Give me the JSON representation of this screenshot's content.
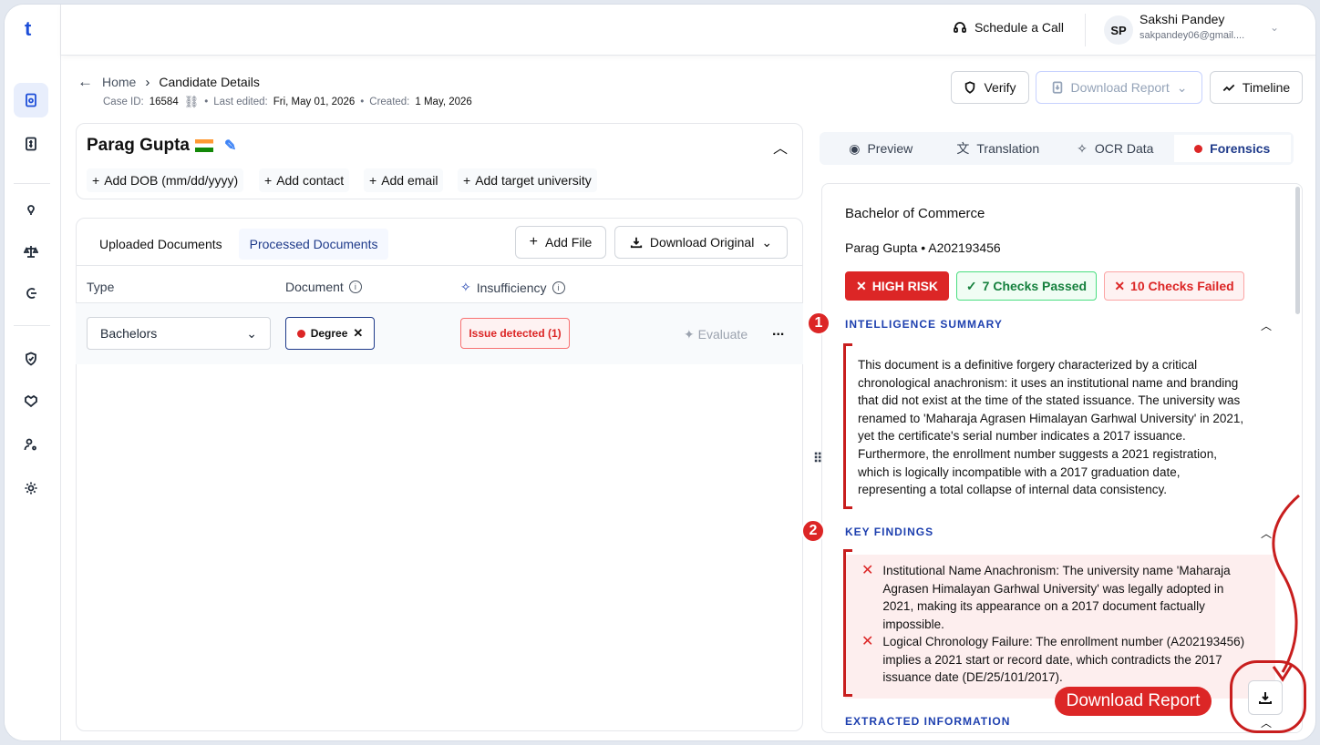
{
  "topbar": {
    "schedule_label": "Schedule a Call",
    "user_initials": "SP",
    "user_name": "Sakshi Pandey",
    "user_email": "sakpandey06@gmail...."
  },
  "breadcrumb": {
    "home": "Home",
    "current": "Candidate Details"
  },
  "meta": {
    "case_label": "Case ID:",
    "case_id": "16584",
    "edited_label": "Last edited:",
    "edited": "Fri, May 01, 2026",
    "created_label": "Created:",
    "created": "1 May, 2026"
  },
  "actions": {
    "verify": "Verify",
    "download_report": "Download Report",
    "timeline": "Timeline"
  },
  "candidate": {
    "name": "Parag Gupta",
    "add_links": [
      "Add DOB (mm/dd/yyyy)",
      "Add contact",
      "Add email",
      "Add target university"
    ]
  },
  "documents": {
    "tabs": [
      "Uploaded Documents",
      "Processed Documents"
    ],
    "add_file": "Add File",
    "download_original": "Download Original",
    "columns": {
      "type": "Type",
      "document": "Document",
      "insufficiency": "Insufficiency"
    },
    "row": {
      "type": "Bachelors",
      "document": "Degree",
      "issue": "Issue detected (1)",
      "evaluate": "Evaluate",
      "more": "..."
    }
  },
  "right_tabs": [
    "Preview",
    "Translation",
    "OCR Data",
    "Forensics"
  ],
  "report": {
    "title": "Bachelor of Commerce",
    "subtitle": "Parag Gupta • A202193456",
    "risk": "HIGH RISK",
    "passed": "7 Checks Passed",
    "failed": "10 Checks Failed",
    "summary_heading": "INTELLIGENCE SUMMARY",
    "summary_lines": [
      "This document is a definitive forgery characterized by a critical",
      "chronological anachronism: it uses an institutional name and branding",
      "that did not exist at the time of the stated issuance. The university was",
      "renamed to 'Maharaja Agrasen Himalayan Garhwal University' in 2021,",
      "yet the certificate's serial number indicates a 2017 issuance.",
      "Furthermore, the enrollment number suggests a 2021 registration,",
      "which is logically incompatible with a 2017 graduation date,",
      "representing a total collapse of internal data consistency."
    ],
    "findings_heading": "KEY FINDINGS",
    "findings": [
      [
        "Institutional Name Anachronism: The university name 'Maharaja",
        "Agrasen Himalayan Garhwal University' was legally adopted in",
        "2021, making its appearance on a 2017 document factually",
        "impossible."
      ],
      [
        "Logical Chronology Failure: The enrollment number (A202193456)",
        "implies a 2021 start or record date, which contradicts the 2017",
        "issuance date (DE/25/101/2017)."
      ]
    ],
    "extracted_heading": "EXTRACTED INFORMATION"
  },
  "annotations": {
    "badge1": "1",
    "badge2": "2",
    "callout": "Download Report"
  },
  "colors": {
    "accent": "#1e40af",
    "danger": "#dc2626",
    "success": "#15803d"
  }
}
